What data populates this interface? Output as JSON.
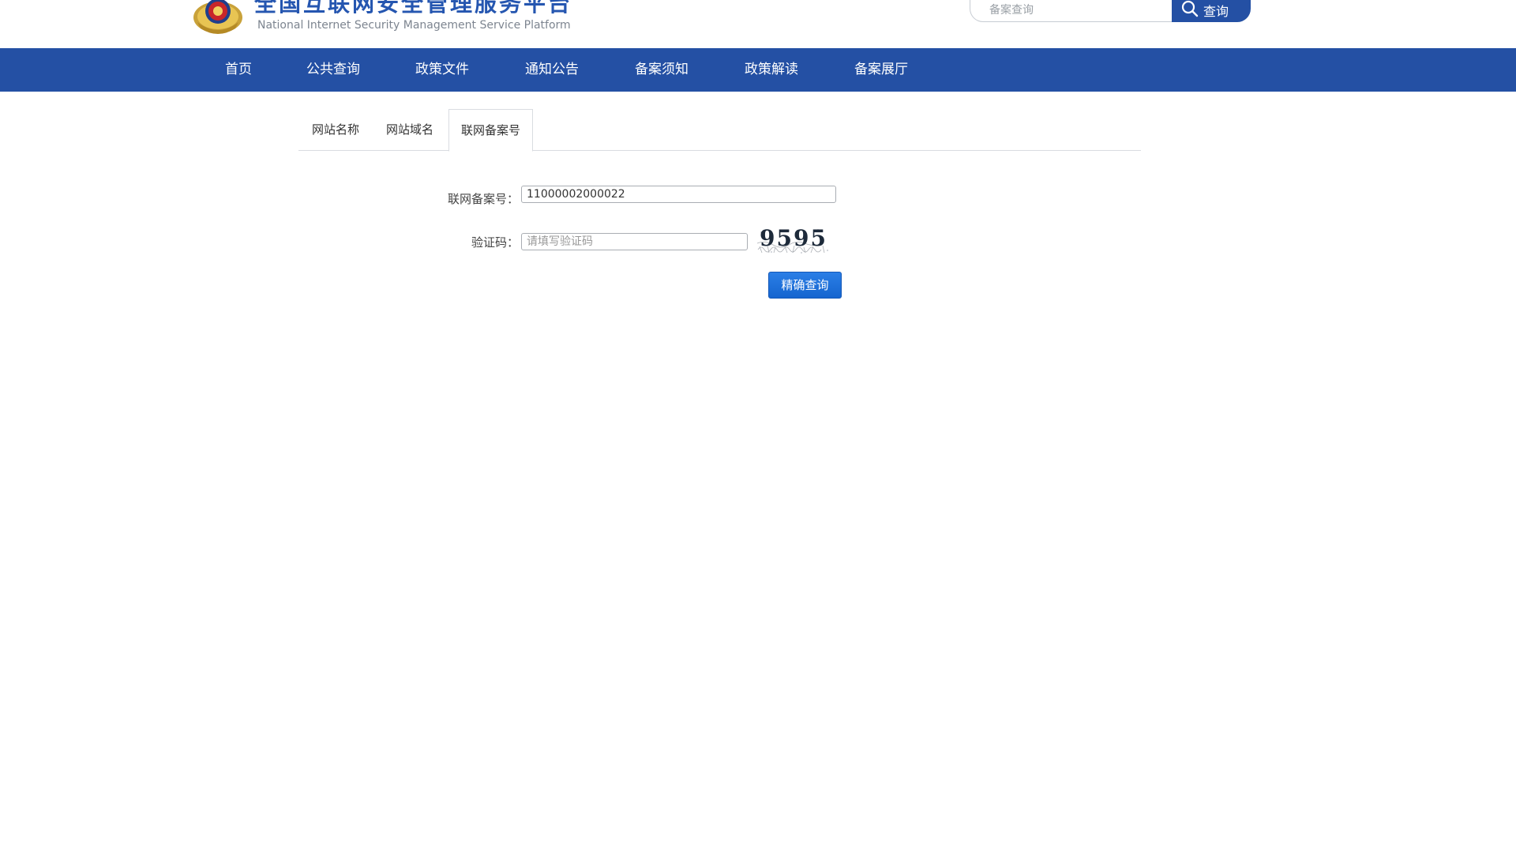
{
  "header": {
    "title": "全国互联网安全管理服务平台",
    "subtitle": "National Internet Security Management Service Platform",
    "search": {
      "placeholder": "备案查询",
      "button_label": "查询"
    }
  },
  "nav": {
    "items": [
      {
        "label": "首页"
      },
      {
        "label": "公共查询"
      },
      {
        "label": "政策文件"
      },
      {
        "label": "通知公告"
      },
      {
        "label": "备案须知"
      },
      {
        "label": "政策解读"
      },
      {
        "label": "备案展厅"
      }
    ]
  },
  "tabs": [
    {
      "label": "网站名称",
      "active": false
    },
    {
      "label": "网站域名",
      "active": false
    },
    {
      "label": "联网备案号",
      "active": true
    }
  ],
  "form": {
    "record_number": {
      "label": "联网备案号：",
      "value": "11000002000022"
    },
    "captcha": {
      "label": "验证码：",
      "placeholder": "请填写验证码",
      "code": "9595"
    },
    "submit_label": "精确查询"
  },
  "colors": {
    "brand_blue": "#2450a4",
    "title_blue": "#2556b0",
    "button_blue": "#1565cf"
  }
}
